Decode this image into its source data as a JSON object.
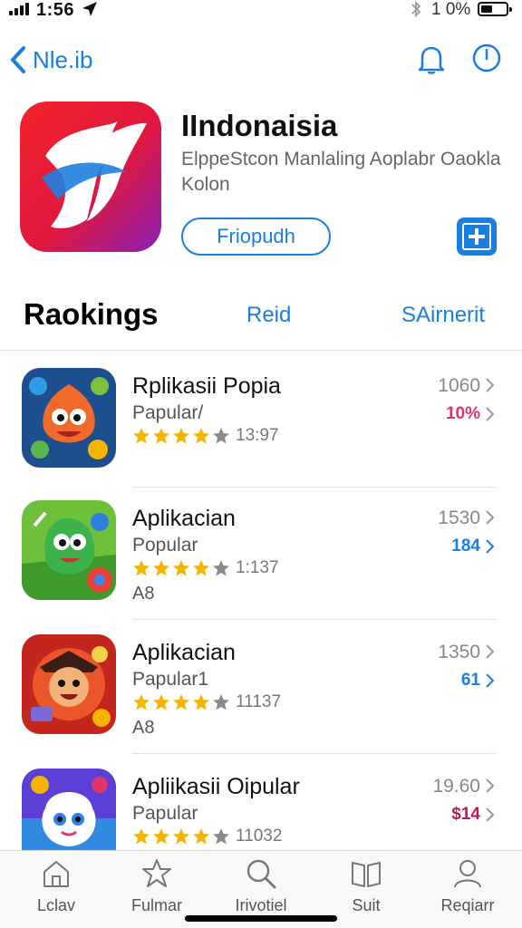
{
  "status_bar": {
    "time": "1:56",
    "battery_pct": "1 0%"
  },
  "nav": {
    "back_label": "Nle.ib"
  },
  "app": {
    "title": "IIndonaisia",
    "subtitle": "ElppeStcon Manlaling Aoplabr Oaokla Kolon",
    "get_label": "Friopudh"
  },
  "section": {
    "title": "Raokings",
    "link1": "Reid",
    "link2": "SAirnerit"
  },
  "list": [
    {
      "name": "Rplikasii Popia",
      "sub": "Papular/",
      "rating": "13:97",
      "extra": "",
      "count": "1060",
      "metric": "10%",
      "metric_color": "#e0356b"
    },
    {
      "name": "Aplikacian",
      "sub": "Popular",
      "rating": "1:137",
      "extra": "A8",
      "count": "1530",
      "metric": "184",
      "metric_color": "#1a7ee0"
    },
    {
      "name": "Aplikacian",
      "sub": "Papular1",
      "rating": "11137",
      "extra": "A8",
      "count": "1350",
      "metric": "61",
      "metric_color": "#1a7ee0"
    },
    {
      "name": "Apliikasii Oipular",
      "sub": "Papular",
      "rating": "11032",
      "extra": "",
      "count": "19.60",
      "metric": "$14",
      "metric_color": "#c2185b"
    }
  ],
  "tabs": [
    {
      "label": "Lclav",
      "icon": "home-icon"
    },
    {
      "label": "Fulmar",
      "icon": "star-icon"
    },
    {
      "label": "Irivotiel",
      "icon": "search-icon"
    },
    {
      "label": "Suit",
      "icon": "book-icon"
    },
    {
      "label": "Reqiarr",
      "icon": "person-icon"
    }
  ],
  "colors": {
    "accent": "#1a7ee0",
    "star": "#f5b400"
  }
}
